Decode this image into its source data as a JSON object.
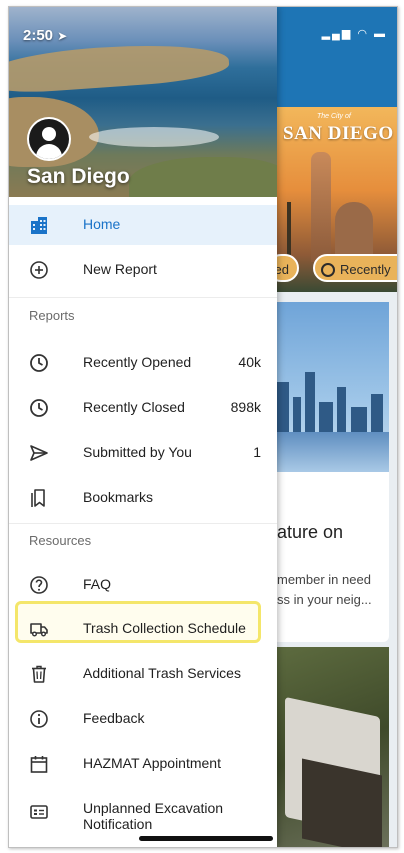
{
  "status_bar": {
    "time": "2:50",
    "location_glyph": "➤",
    "right_icons": "▂▄▆ ◠ ▬"
  },
  "drawer": {
    "city_name": "San Diego",
    "nav": {
      "home": {
        "label": "Home",
        "icon": "building-icon"
      },
      "new_report": {
        "label": "New Report",
        "icon": "plus-circle-icon"
      }
    },
    "reports_section": {
      "title": "Reports",
      "items": [
        {
          "label": "Recently Opened",
          "count": "40k",
          "icon": "clock-icon"
        },
        {
          "label": "Recently Closed",
          "count": "898k",
          "icon": "clock-icon"
        },
        {
          "label": "Submitted by You",
          "count": "1",
          "icon": "send-icon"
        },
        {
          "label": "Bookmarks",
          "count": "",
          "icon": "bookmarks-icon"
        }
      ]
    },
    "resources_section": {
      "title": "Resources",
      "items": [
        {
          "label": "FAQ",
          "icon": "question-circle-icon"
        },
        {
          "label": "Trash Collection Schedule",
          "icon": "truck-icon"
        },
        {
          "label": "Additional Trash Services",
          "icon": "trash-can-icon"
        },
        {
          "label": "Feedback",
          "icon": "info-circle-icon"
        },
        {
          "label": "HAZMAT Appointment",
          "icon": "calendar-icon"
        },
        {
          "label": "Unplanned Excavation Notification",
          "icon": "id-card-icon"
        }
      ]
    }
  },
  "background": {
    "hero_title": "SAN DIEGO",
    "hero_subtitle": "The City of",
    "chips": [
      "ed",
      "Recently"
    ],
    "card_title": "ature on",
    "card_text_line1": "member in need",
    "card_text_line2": "ss in your neig..."
  },
  "colors": {
    "accent_blue": "#1a73c8",
    "active_bg": "#e6f1fb",
    "highlight": "#f4e66a",
    "header_blue": "#1e75b5"
  }
}
